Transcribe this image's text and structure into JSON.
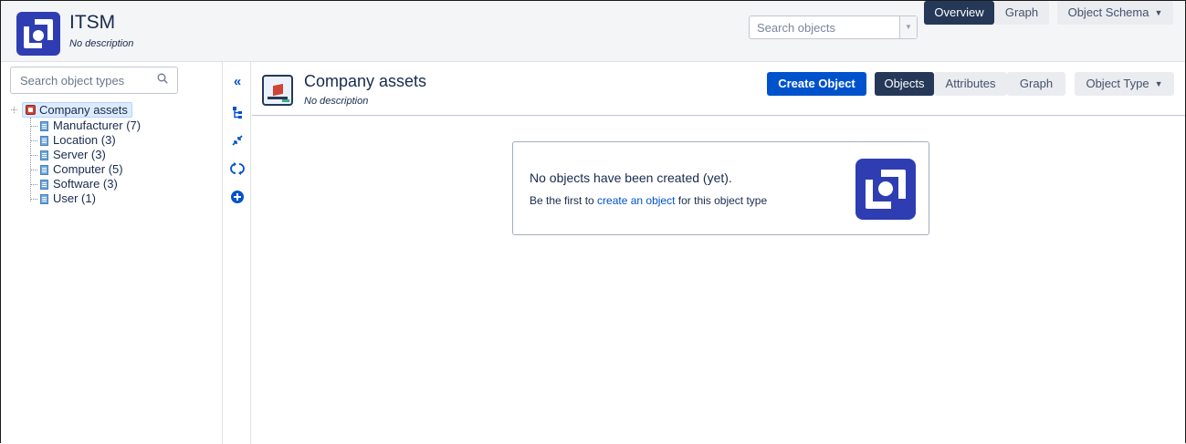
{
  "header": {
    "app_title": "ITSM",
    "app_description": "No description",
    "search_placeholder": "Search objects",
    "tabs": [
      {
        "label": "Overview",
        "active": true
      },
      {
        "label": "Graph",
        "active": false
      }
    ],
    "schema_menu_label": "Object Schema"
  },
  "left_panel": {
    "search_placeholder": "Search object types",
    "tree": {
      "root": {
        "label": "Company assets",
        "selected": true
      },
      "items": [
        {
          "label": "Manufacturer (7)"
        },
        {
          "label": "Location (3)"
        },
        {
          "label": "Server (3)"
        },
        {
          "label": "Computer (5)"
        },
        {
          "label": "Software (3)"
        },
        {
          "label": "User (1)"
        }
      ]
    }
  },
  "side_toolbar": {
    "tools": [
      "collapse-panel-icon",
      "tree-structure-icon",
      "collapse-all-icon",
      "refresh-icon",
      "add-circle-icon"
    ]
  },
  "object_type": {
    "title": "Company assets",
    "description": "No description",
    "create_label": "Create Object",
    "tabs": [
      {
        "label": "Objects",
        "active": true
      },
      {
        "label": "Attributes",
        "active": false
      },
      {
        "label": "Graph",
        "active": false
      }
    ],
    "type_menu_label": "Object Type"
  },
  "empty_state": {
    "heading": "No objects have been created (yet).",
    "text_before": "Be the first to ",
    "link_text": "create an object",
    "text_after": " for this object type"
  },
  "colors": {
    "brand": "#2f3db3",
    "primary_button": "#0052cc",
    "active_tab": "#253858",
    "selected_tree": "#deebff"
  }
}
